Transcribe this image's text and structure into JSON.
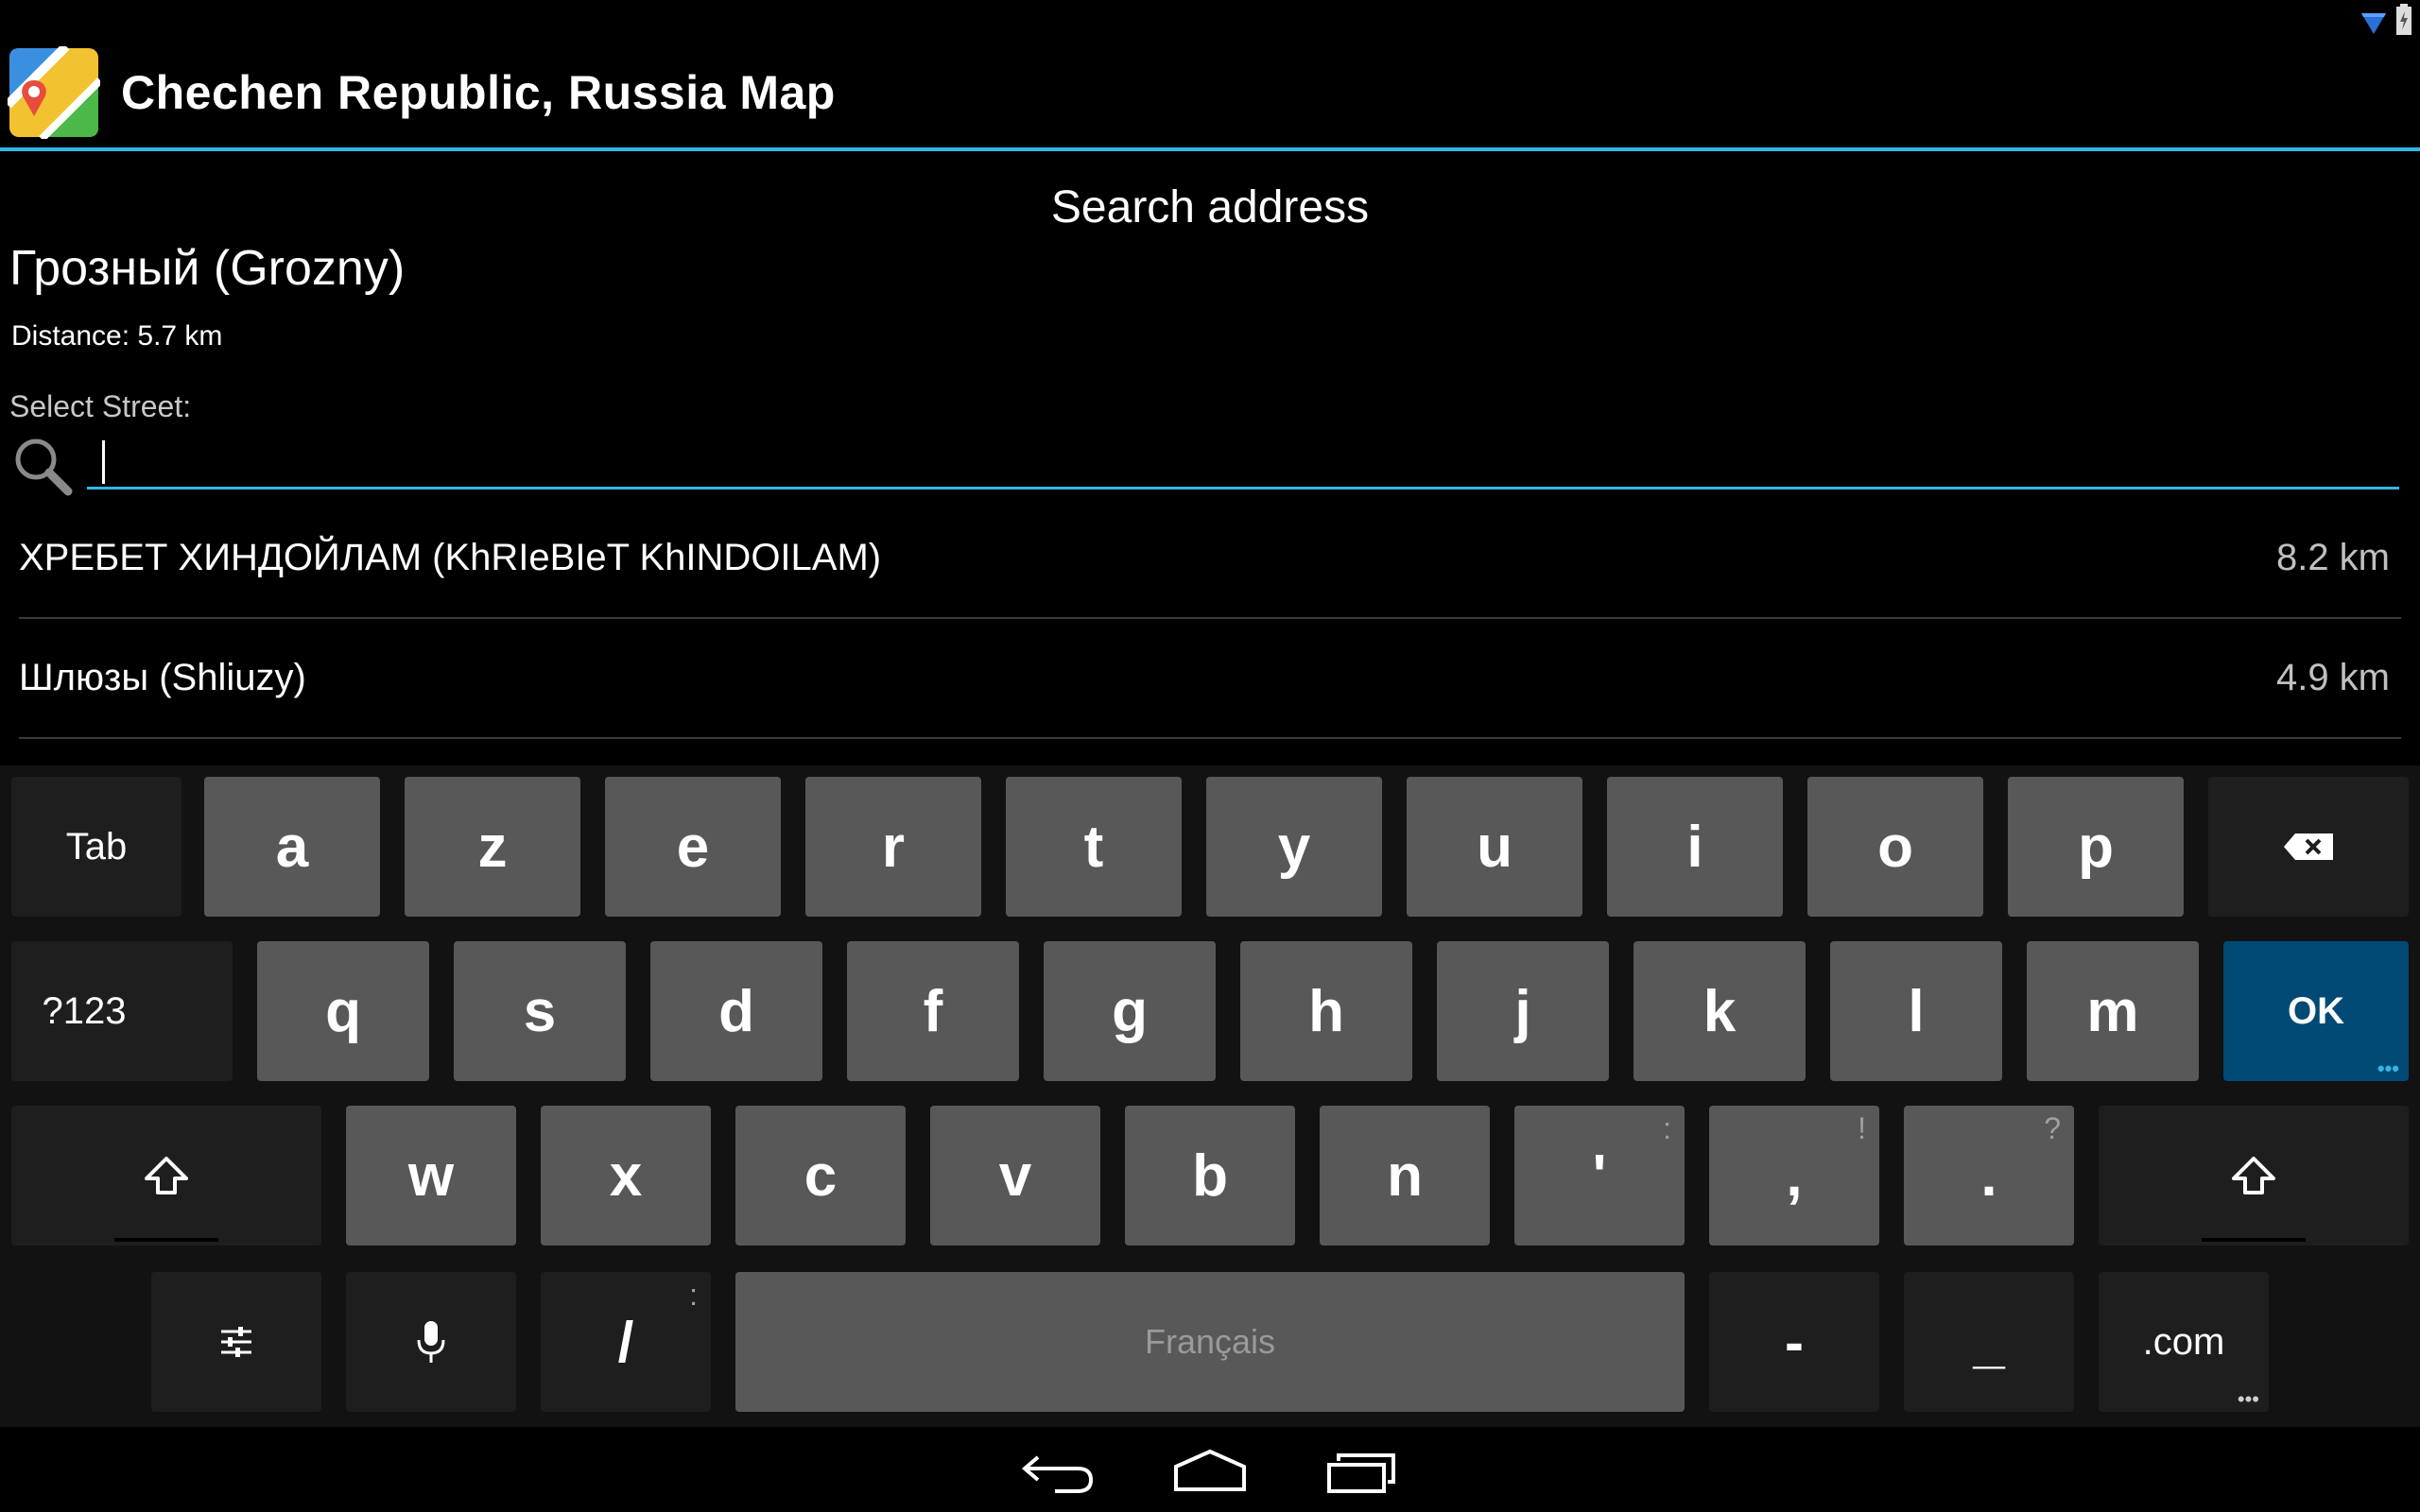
{
  "app": {
    "title": "Chechen Republic, Russia Map"
  },
  "dialog": {
    "title": "Search address",
    "city": "Грозный (Grozny)",
    "distance": "Distance: 5.7 km",
    "select_label": "Select Street:",
    "search_value": "",
    "search_placeholder": ""
  },
  "streets": [
    {
      "name": "ХРЕБЕТ ХИНДОЙЛАМ (KhRIeBIeT KhINDOILAM)",
      "distance": "8.2 km"
    },
    {
      "name": "Шлюзы (Shliuzy)",
      "distance": "4.9 km"
    }
  ],
  "keyboard": {
    "row1": {
      "tab": "Tab",
      "keys": [
        "a",
        "z",
        "e",
        "r",
        "t",
        "y",
        "u",
        "i",
        "o",
        "p"
      ]
    },
    "row2": {
      "symbols": "?123",
      "keys": [
        "q",
        "s",
        "d",
        "f",
        "g",
        "h",
        "j",
        "k",
        "l",
        "m"
      ],
      "ok": "OK"
    },
    "row3": {
      "keys": [
        "w",
        "x",
        "c",
        "v",
        "b",
        "n"
      ],
      "apostrophe": "'",
      "apostrophe_hint": ":",
      "comma": ",",
      "comma_hint": "!",
      "period": ".",
      "period_hint": "?"
    },
    "row4": {
      "slash": "/",
      "slash_hint": ":",
      "space": "Français",
      "dash": "-",
      "underscore": "_",
      "dotcom": ".com"
    }
  },
  "colors": {
    "accent": "#33b5e5",
    "key_letter": "#585858",
    "key_function": "#1e1e1e",
    "key_ok": "#004a75"
  },
  "icons": {
    "app": "map-pin-icon",
    "search": "magnifier-icon",
    "backspace": "backspace-icon",
    "shift": "shift-arrow-icon",
    "settings": "sliders-icon",
    "mic": "microphone-icon",
    "nav_back": "back-arrow-icon",
    "nav_home": "home-icon",
    "nav_recents": "recent-apps-icon"
  }
}
